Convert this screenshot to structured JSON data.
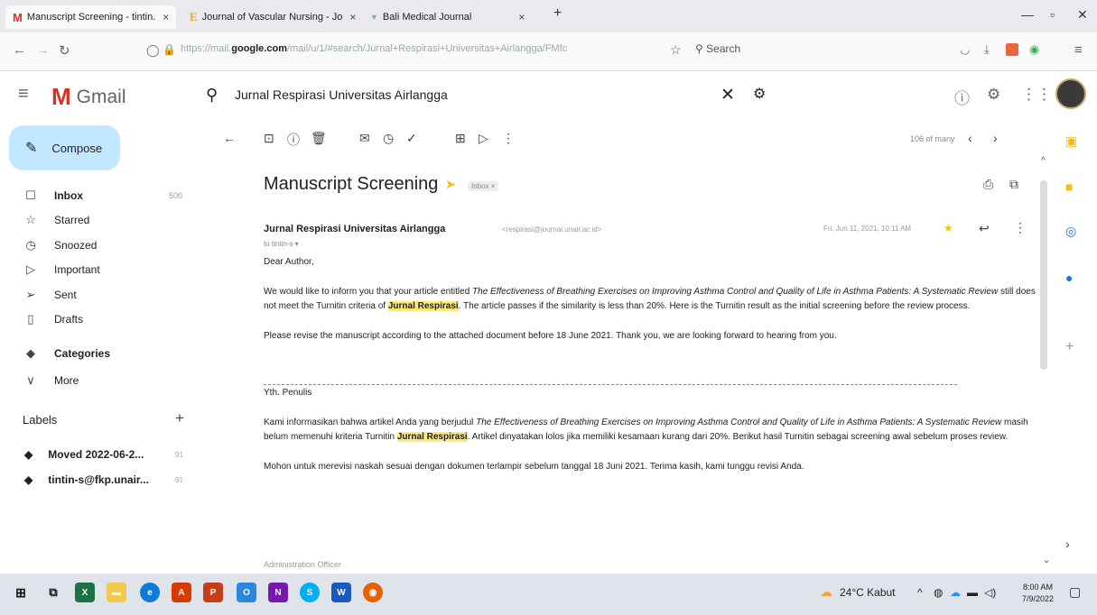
{
  "browser": {
    "tabs": [
      {
        "icon": "M",
        "title": "Manuscript Screening - tintin.",
        "close": "×"
      },
      {
        "icon": "E",
        "title": "Journal of Vascular Nursing - Jo",
        "close": "×"
      },
      {
        "icon": "▼",
        "title": "Bali Medical Journal",
        "close": "×"
      }
    ],
    "new_tab": "+",
    "url_prefix": "https://mail.",
    "url_domain": "google.com",
    "url_rest": "/mail/u/1/#search/Jurnal+Respirasi+Universitas+Airlangga/FMfc",
    "search_label": "Search"
  },
  "gmail": {
    "logo_text": "Gmail",
    "search_query": "Jurnal Respirasi Universitas Airlangga",
    "compose_label": "Compose",
    "nav": [
      {
        "icon": "inbox-icon",
        "glyph": "☐",
        "label": "Inbox",
        "count": "500",
        "bold": true
      },
      {
        "icon": "star-icon",
        "glyph": "☆",
        "label": "Starred",
        "count": "",
        "bold": false
      },
      {
        "icon": "snooze-icon",
        "glyph": "◷",
        "label": "Snoozed",
        "count": "",
        "bold": false
      },
      {
        "icon": "important-icon",
        "glyph": "▷",
        "label": "Important",
        "count": "",
        "bold": false
      },
      {
        "icon": "send-icon",
        "glyph": "➢",
        "label": "Sent",
        "count": "",
        "bold": false
      },
      {
        "icon": "draft-icon",
        "glyph": "▯",
        "label": "Drafts",
        "count": "",
        "bold": false
      },
      {
        "icon": "label-icon",
        "glyph": "◆",
        "label": "Categories",
        "count": "",
        "bold": true
      },
      {
        "icon": "chevron-down-icon",
        "glyph": "∨",
        "label": "More",
        "count": "",
        "bold": false
      }
    ],
    "labels_heading": "Labels",
    "labels": [
      {
        "label": "Moved 2022-06-2...",
        "count": "91"
      },
      {
        "label": "tintin-s@fkp.unair...",
        "count": "91"
      }
    ],
    "pager": "106 of many"
  },
  "message": {
    "subject": "Manuscript Screening",
    "inbox_tag": "Inbox ×",
    "sender_name": "Jurnal Respirasi Universitas Airlangga",
    "sender_email": "<respirasi@journal.unair.ac.id>",
    "date": "Fri, Jun 11, 2021, 10:11 AM",
    "to": "to tintin-s ▾",
    "greeting_en": "Dear Author,",
    "para1_a": "We would like to inform you that your article entitled ",
    "para1_title": "The Effectiveness of Breathing Exercises on Improving Asthma Control and Quality of Life in Asthma Patients: A Systematic Review",
    "para1_b": " still does not meet the Turnitin criteria of ",
    "para1_hl": "Jurnal Respirasi",
    "para1_c": ". The article passes if the similarity is less than 20%. Here is the Turnitin result as the initial screening before the review process.",
    "para2": "Please revise the manuscript according to the attached document before 18 June 2021. Thank you, we are looking forward to hearing from you.",
    "greeting_id": "Yth. Penulis",
    "para3_a": "Kami informasikan bahwa artikel Anda yang berjudul ",
    "para3_title": "The Effectiveness of Breathing Exercises on Improving Asthma Control and Quality of Life in Asthma Patients: A Systematic Review",
    "para3_b": " masih belum memenuhi kriteria Turnitin ",
    "para3_hl": "Jurnal Respirasi",
    "para3_c": ". Artikel dinyatakan lolos jika memiliki kesamaan kurang dari 20%. Berikut hasil Turnitin sebagai screening awal sebelum proses review.",
    "para4": "Mohon untuk merevisi naskah sesuai dengan dokumen terlampir sebelum tanggal 18 Juni 2021. Terima kasih, kami tunggu revisi Anda.",
    "signature": "Administration Officer"
  },
  "taskbar": {
    "weather": "24°C Kabut",
    "time": "8:00 AM",
    "date": "7/9/2022"
  }
}
